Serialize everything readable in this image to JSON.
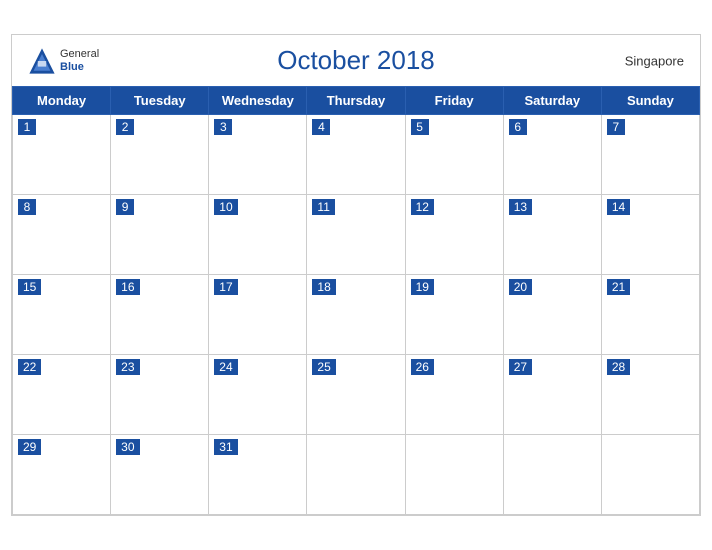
{
  "header": {
    "logo": {
      "general": "General",
      "blue": "Blue",
      "icon_label": "general-blue-logo"
    },
    "title": "October 2018",
    "country": "Singapore"
  },
  "weekdays": [
    "Monday",
    "Tuesday",
    "Wednesday",
    "Thursday",
    "Friday",
    "Saturday",
    "Sunday"
  ],
  "weeks": [
    [
      1,
      2,
      3,
      4,
      5,
      6,
      7
    ],
    [
      8,
      9,
      10,
      11,
      12,
      13,
      14
    ],
    [
      15,
      16,
      17,
      18,
      19,
      20,
      21
    ],
    [
      22,
      23,
      24,
      25,
      26,
      27,
      28
    ],
    [
      29,
      30,
      31,
      null,
      null,
      null,
      null
    ]
  ]
}
